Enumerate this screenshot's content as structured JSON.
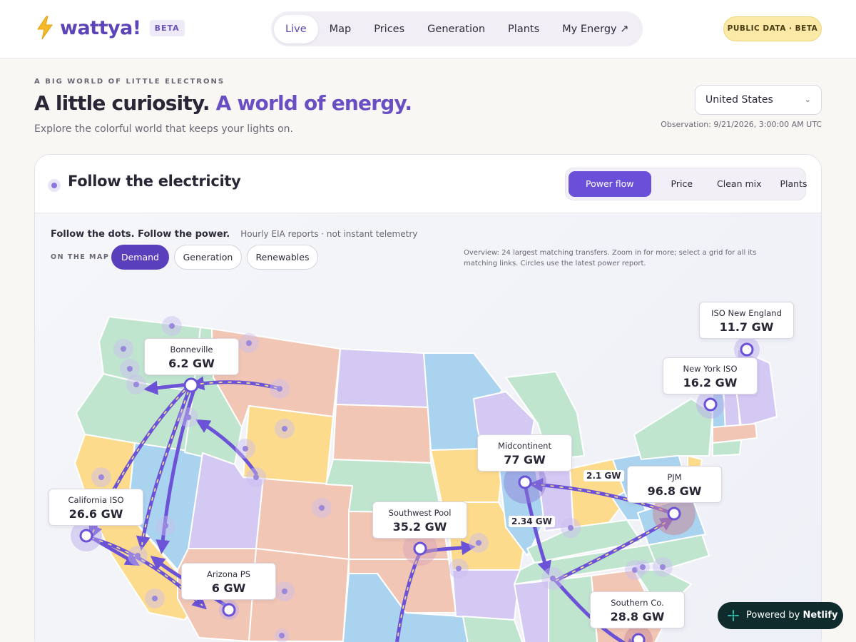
{
  "header": {
    "brand": "wattya!",
    "beta_badge": "BETA",
    "nav": [
      "Live",
      "Map",
      "Prices",
      "Generation",
      "Plants",
      "My Energy ↗"
    ],
    "active_nav": "Live",
    "public_pill": "PUBLIC DATA · BETA"
  },
  "hero": {
    "eyebrow": "A BIG WORLD OF LITTLE ELECTRONS",
    "headline_a": "A little curiosity.",
    "headline_b": "A world of energy.",
    "subhead": "Explore the colorful world that keeps your lights on.",
    "country": "United States",
    "observation": "Observation: 9/21/2026, 3:00:00 AM UTC"
  },
  "card": {
    "title": "Follow the electricity",
    "views": [
      "Power flow",
      "Price",
      "Clean mix",
      "Plants"
    ],
    "active_view": "Power flow",
    "follow_title": "Follow the dots. Follow the power.",
    "follow_sub": "Hourly EIA reports · not instant telemetry",
    "on_map_label": "ON THE MAP",
    "layers": [
      "Demand",
      "Generation",
      "Renewables"
    ],
    "active_layer": "Demand",
    "overview": "Overview: 24 largest matching transfers. Zoom in for more; select a grid for all its matching links. Circles use the latest power report."
  },
  "regions": [
    {
      "name": "Bonneville",
      "value": "6.2 GW"
    },
    {
      "name": "California ISO",
      "value": "26.6 GW"
    },
    {
      "name": "Arizona PS",
      "value": "6 GW"
    },
    {
      "name": "Southwest Pool",
      "value": "35.2 GW"
    },
    {
      "name": "Midcontinent",
      "value": "77 GW"
    },
    {
      "name": "PJM",
      "value": "96.8 GW"
    },
    {
      "name": "New York ISO",
      "value": "16.2 GW"
    },
    {
      "name": "ISO New England",
      "value": "11.7 GW"
    },
    {
      "name": "Southern Co.",
      "value": "28.8 GW"
    }
  ],
  "flow_labels": [
    "2.1 GW",
    "2.34 GW"
  ],
  "netlify": {
    "prefix": "Powered by",
    "brand": "Netlify"
  },
  "colors": {
    "accent": "#6a4fd8",
    "flow": "#6b52d6",
    "state_pink": "#f2c6b4",
    "state_blue": "#a9d3ef",
    "state_green": "#bfe5cf",
    "state_yellow": "#fddb8c",
    "state_lavender": "#d4c9f3"
  }
}
